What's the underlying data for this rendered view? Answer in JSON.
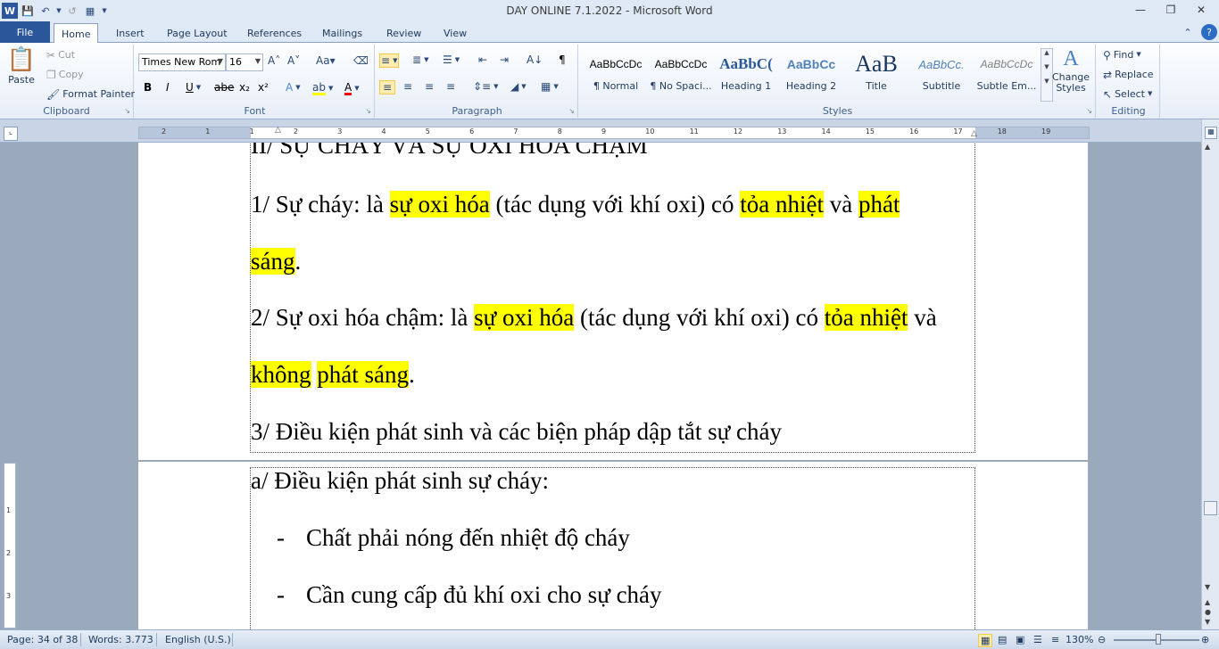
{
  "app": {
    "title": "DAY ONLINE 7.1.2022  -  Microsoft Word"
  },
  "tabs": [
    "File",
    "Home",
    "Insert",
    "Page Layout",
    "References",
    "Mailings",
    "Review",
    "View"
  ],
  "clipboard": {
    "paste": "Paste",
    "cut": "Cut",
    "copy": "Copy",
    "format_painter": "Format Painter",
    "label": "Clipboard"
  },
  "font": {
    "name": "Times New Rom",
    "size": "16",
    "label": "Font"
  },
  "paragraph": {
    "label": "Paragraph"
  },
  "styles": {
    "label": "Styles",
    "items": [
      {
        "preview": "AaBbCcDc",
        "name": "¶ Normal"
      },
      {
        "preview": "AaBbCcDc",
        "name": "¶ No Spaci..."
      },
      {
        "preview": "AaBbC(",
        "name": "Heading 1"
      },
      {
        "preview": "AaBbCc",
        "name": "Heading 2"
      },
      {
        "preview": "AaB",
        "name": "Title"
      },
      {
        "preview": "AaBbCc.",
        "name": "Subtitle"
      },
      {
        "preview": "AaBbCcDc",
        "name": "Subtle Em..."
      }
    ],
    "change_styles": "Change Styles"
  },
  "editing": {
    "find": "Find",
    "replace": "Replace",
    "select": "Select",
    "label": "Editing"
  },
  "ruler_numbers": [
    "2",
    "1",
    "1",
    "2",
    "3",
    "4",
    "5",
    "6",
    "7",
    "8",
    "9",
    "10",
    "11",
    "12",
    "13",
    "14",
    "15",
    "16",
    "17",
    "18",
    "19"
  ],
  "vruler_numbers": [
    "1",
    "2",
    "3"
  ],
  "document": {
    "heading": "II/ SỰ CHÁY VÀ SỰ OXI HÓA CHẬM",
    "p1a": "1/ Sự cháy: là ",
    "p1b": "sự oxi hóa",
    "p1c": " (tác dụng với khí oxi) có ",
    "p1d": "tỏa nhiệt",
    "p1e": " và ",
    "p1f": "phát",
    "p1g": "sáng",
    "p1h": ".",
    "p2a": "2/ Sự oxi hóa chậm: là ",
    "p2b": "sự oxi hóa",
    "p2c": " (tác dụng với khí oxi) có ",
    "p2d": "tỏa nhiệt",
    "p2e": " và",
    "p2f": "không",
    "p2g": "phát sáng",
    "p2h": ".",
    "p3": "3/ Điều kiện phát sinh và các biện pháp dập tắt sự cháy",
    "p4": "a/ Điều kiện phát sinh sự cháy:",
    "bullet_char": "-",
    "b1": "Chất phải nóng đến nhiệt độ cháy",
    "b2": "Cần cung cấp đủ khí oxi cho sự cháy"
  },
  "status": {
    "page": "Page: 34 of 38",
    "words": "Words: 3.773",
    "language": "English (U.S.)",
    "zoom": "130%"
  }
}
